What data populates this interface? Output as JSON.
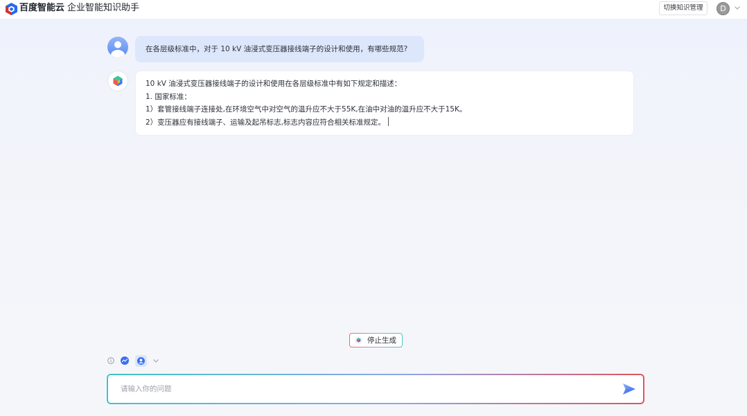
{
  "header": {
    "logo_icon": "baidu-ai-cloud-logo-icon",
    "brand": "百度智能云",
    "product": "企业智能知识助手",
    "switch_button_label": "切换知识管理",
    "avatar_initial": "D",
    "account_menu_icon": "chevron-down-icon"
  },
  "chat": {
    "user_message": {
      "avatar_icon": "user-avatar-icon",
      "text": "在各层级标准中，对于 10 kV 油浸式变压器接线端子的设计和使用，有哪些规范?"
    },
    "assistant_message": {
      "avatar_icon": "assistant-logo-icon",
      "lines": [
        "10 kV 油浸式变压器接线端子的设计和使用在各层级标准中有如下规定和描述：",
        "1. 国家标准：",
        "1）套管接线端子连接处,在环境空气中对空气的温升应不大于55K,在油中对油的温升应不大于15K。",
        "2）变压器应有接线端子、运输及起吊标志,标志内容应符合相关标准规定。"
      ],
      "is_streaming": true
    }
  },
  "stop_button": {
    "icon": "stop-generating-icon",
    "label": "停止生成"
  },
  "toolbar": {
    "icons": [
      "info-circle-icon",
      "trend-icon",
      "knowledge-assistant-icon",
      "chevron-down-icon"
    ]
  },
  "input": {
    "placeholder": "请输入你的问题",
    "value": "",
    "send_icon": "send-icon"
  },
  "colors": {
    "brand_blue": "#2468f2",
    "user_bubble": "#dde7fb",
    "assistant_bubble": "#ffffff",
    "input_border_start": "#3fc5c6",
    "input_border_end": "#e0535d",
    "send_icon": "#4a7df3"
  }
}
